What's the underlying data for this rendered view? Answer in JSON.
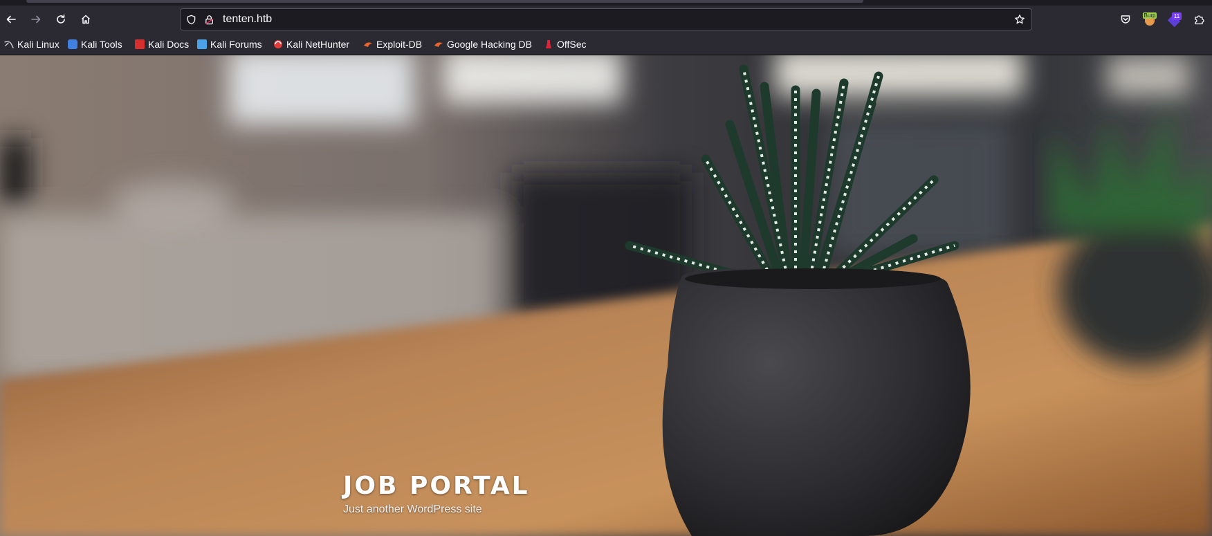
{
  "browser": {
    "url": "tenten.htb",
    "toolbar_icons": {
      "back": "arrow-left-icon",
      "forward": "arrow-right-icon",
      "reload": "reload-icon",
      "home": "home-icon",
      "tracking": "shield-icon",
      "lock": "lock-icon",
      "bookmark": "star-icon",
      "pocket": "pocket-icon",
      "burp": "burp-extension-icon",
      "extension2": "purple-extension-icon",
      "extensions": "puzzle-icon"
    },
    "burp_label": "Burp",
    "extension_badge": "11"
  },
  "bookmarks": [
    {
      "label": "Kali Linux",
      "icon": "kali-dragon-icon"
    },
    {
      "label": "Kali Tools",
      "icon": "kali-tools-icon"
    },
    {
      "label": "Kali Docs",
      "icon": "kali-docs-icon"
    },
    {
      "label": "Kali Forums",
      "icon": "kali-forums-icon"
    },
    {
      "label": "Kali NetHunter",
      "icon": "nethunter-icon"
    },
    {
      "label": "Exploit-DB",
      "icon": "exploit-db-icon"
    },
    {
      "label": "Google Hacking DB",
      "icon": "ghdb-icon"
    },
    {
      "label": "OffSec",
      "icon": "offsec-icon"
    }
  ],
  "site": {
    "title": "JOB PORTAL",
    "tagline": "Just another WordPress site"
  },
  "colors": {
    "chrome": "#2b2a33",
    "urlbar": "#1c1b22",
    "text": "#fbfbfe"
  }
}
